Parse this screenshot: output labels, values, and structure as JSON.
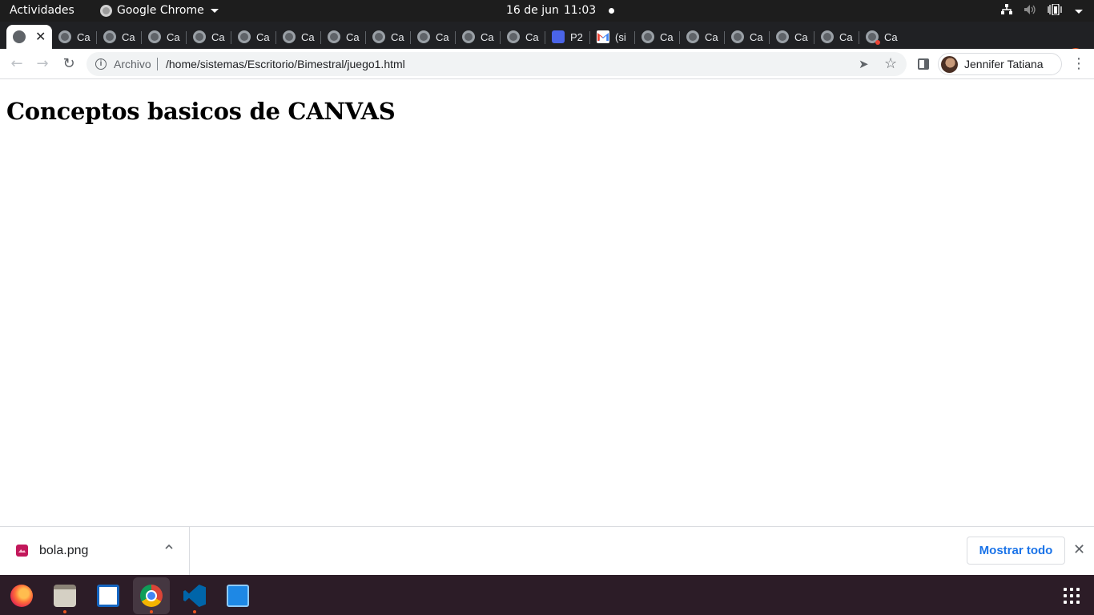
{
  "topbar": {
    "activities": "Actividades",
    "app_name": "Google Chrome",
    "date": "16 de jun",
    "time": "11:03"
  },
  "tabs": [
    {
      "label": "",
      "favicon": "globe-icon",
      "active": true
    },
    {
      "label": "Ca",
      "favicon": "globe-icon"
    },
    {
      "label": "Ca",
      "favicon": "globe-icon"
    },
    {
      "label": "Ca",
      "favicon": "globe-icon"
    },
    {
      "label": "Ca",
      "favicon": "globe-icon"
    },
    {
      "label": "Ca",
      "favicon": "globe-icon"
    },
    {
      "label": "Ca",
      "favicon": "globe-icon"
    },
    {
      "label": "Ca",
      "favicon": "globe-icon"
    },
    {
      "label": "Ca",
      "favicon": "globe-icon"
    },
    {
      "label": "Ca",
      "favicon": "globe-icon"
    },
    {
      "label": "Ca",
      "favicon": "globe-icon"
    },
    {
      "label": "Ca",
      "favicon": "globe-icon"
    },
    {
      "label": "P2",
      "favicon": "contacts-icon"
    },
    {
      "label": "(si",
      "favicon": "gmail-icon"
    },
    {
      "label": "Ca",
      "favicon": "globe-icon"
    },
    {
      "label": "Ca",
      "favicon": "globe-icon"
    },
    {
      "label": "Ca",
      "favicon": "globe-icon"
    },
    {
      "label": "Ca",
      "favicon": "globe-icon"
    },
    {
      "label": "Ca",
      "favicon": "globe-icon"
    },
    {
      "label": "Ca",
      "favicon": "globe-alert-icon"
    }
  ],
  "toolbar": {
    "scheme_label": "Archivo",
    "url": "/home/sistemas/Escritorio/Bimestral/juego1.html",
    "profile_name": "Jennifer Tatiana"
  },
  "page": {
    "heading": "Conceptos basicos de CANVAS"
  },
  "downloads": {
    "file_name": "bola.png",
    "show_all": "Mostrar todo"
  },
  "dock": {
    "apps": [
      "firefox-icon",
      "files-icon",
      "writer-icon",
      "chrome-icon",
      "vscode-icon",
      "system-monitor-icon"
    ]
  },
  "colors": {
    "ubuntu_orange": "#e95420",
    "tab_strip": "#202124",
    "link_blue": "#1a73e8"
  }
}
